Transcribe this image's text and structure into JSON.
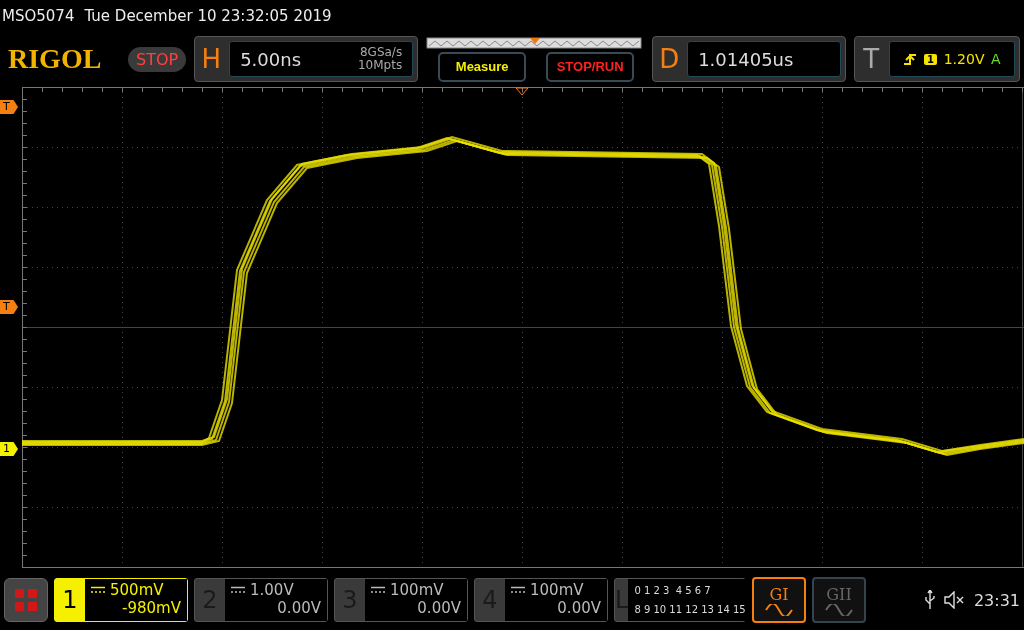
{
  "header": {
    "model": "MSO5074",
    "datetime": "Tue December 10 23:32:05 2019"
  },
  "top_bar": {
    "logo": "RIGOL",
    "run_state": "STOP",
    "horizontal": {
      "label": "H",
      "timebase": "5.00ns",
      "sample_rate": "8GSa/s",
      "memory_depth": "10Mpts"
    },
    "measure_button": "Measure",
    "stop_run_button": "STOP/RUN",
    "delay": {
      "label": "D",
      "value": "1.01405us"
    },
    "trigger": {
      "label": "T",
      "source": "1",
      "level": "1.20V",
      "mode": "A"
    }
  },
  "screen_markers": {
    "trigger_position": {
      "text": "T"
    },
    "trigger_level": {
      "text": "T"
    },
    "channel_offset": {
      "text": "1"
    }
  },
  "channels": [
    {
      "number": "1",
      "scale": "500mV",
      "offset": "-980mV",
      "selected": true
    },
    {
      "number": "2",
      "scale": "1.00V",
      "offset": "0.00V",
      "selected": false
    },
    {
      "number": "3",
      "scale": "100mV",
      "offset": "0.00V",
      "selected": false
    },
    {
      "number": "4",
      "scale": "100mV",
      "offset": "0.00V",
      "selected": false
    }
  ],
  "logic": {
    "label": "L",
    "row_1": "0 1 2 3  4 5 6 7",
    "row_2": "8 9 10 11 12 13 14 15"
  },
  "generators": [
    {
      "label": "GI",
      "selected": true
    },
    {
      "label": "GII",
      "selected": false
    }
  ],
  "status": {
    "time": "23:31"
  }
}
